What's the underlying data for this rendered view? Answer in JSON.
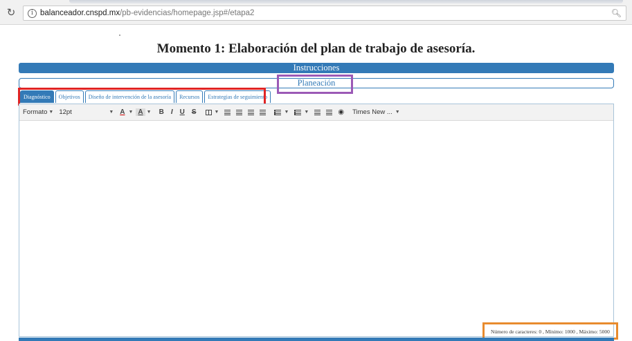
{
  "browser": {
    "url_host": "balanceador.cnspd.mx",
    "url_path": "/pb-evidencias/homepage.jsp#/etapa2",
    "reload_icon": "reload-icon",
    "info_icon": "info-icon",
    "zoom_icon": "zoom-icon"
  },
  "page": {
    "title": "Momento 1: Elaboración del plan de trabajo de asesoría.",
    "instructions_label": "Instrucciones",
    "planning_label": "Planeación"
  },
  "tabs": [
    {
      "label": "Diagnóstico",
      "active": true
    },
    {
      "label": "Objetivos",
      "active": false
    },
    {
      "label": "Diseño de intervención de la asesoría",
      "active": false
    },
    {
      "label": "Recursos",
      "active": false
    },
    {
      "label": "Estrategias de seguimiento",
      "active": false
    }
  ],
  "toolbar": {
    "format_label": "Formato",
    "font_size": "12pt",
    "text_color_label": "A",
    "bg_color_label": "A",
    "bold_label": "B",
    "italic_label": "I",
    "underline_label": "U",
    "strike_label": "S",
    "font_name": "Times New ..."
  },
  "footer": {
    "char_count_text": "Número de caracteres: 0 , Mínimo: 1000 , Máximo: 5000"
  },
  "colors": {
    "primary": "#337ab7",
    "highlight_red": "#e02424",
    "highlight_purple": "#9b59b6",
    "highlight_orange": "#e88b2e"
  }
}
